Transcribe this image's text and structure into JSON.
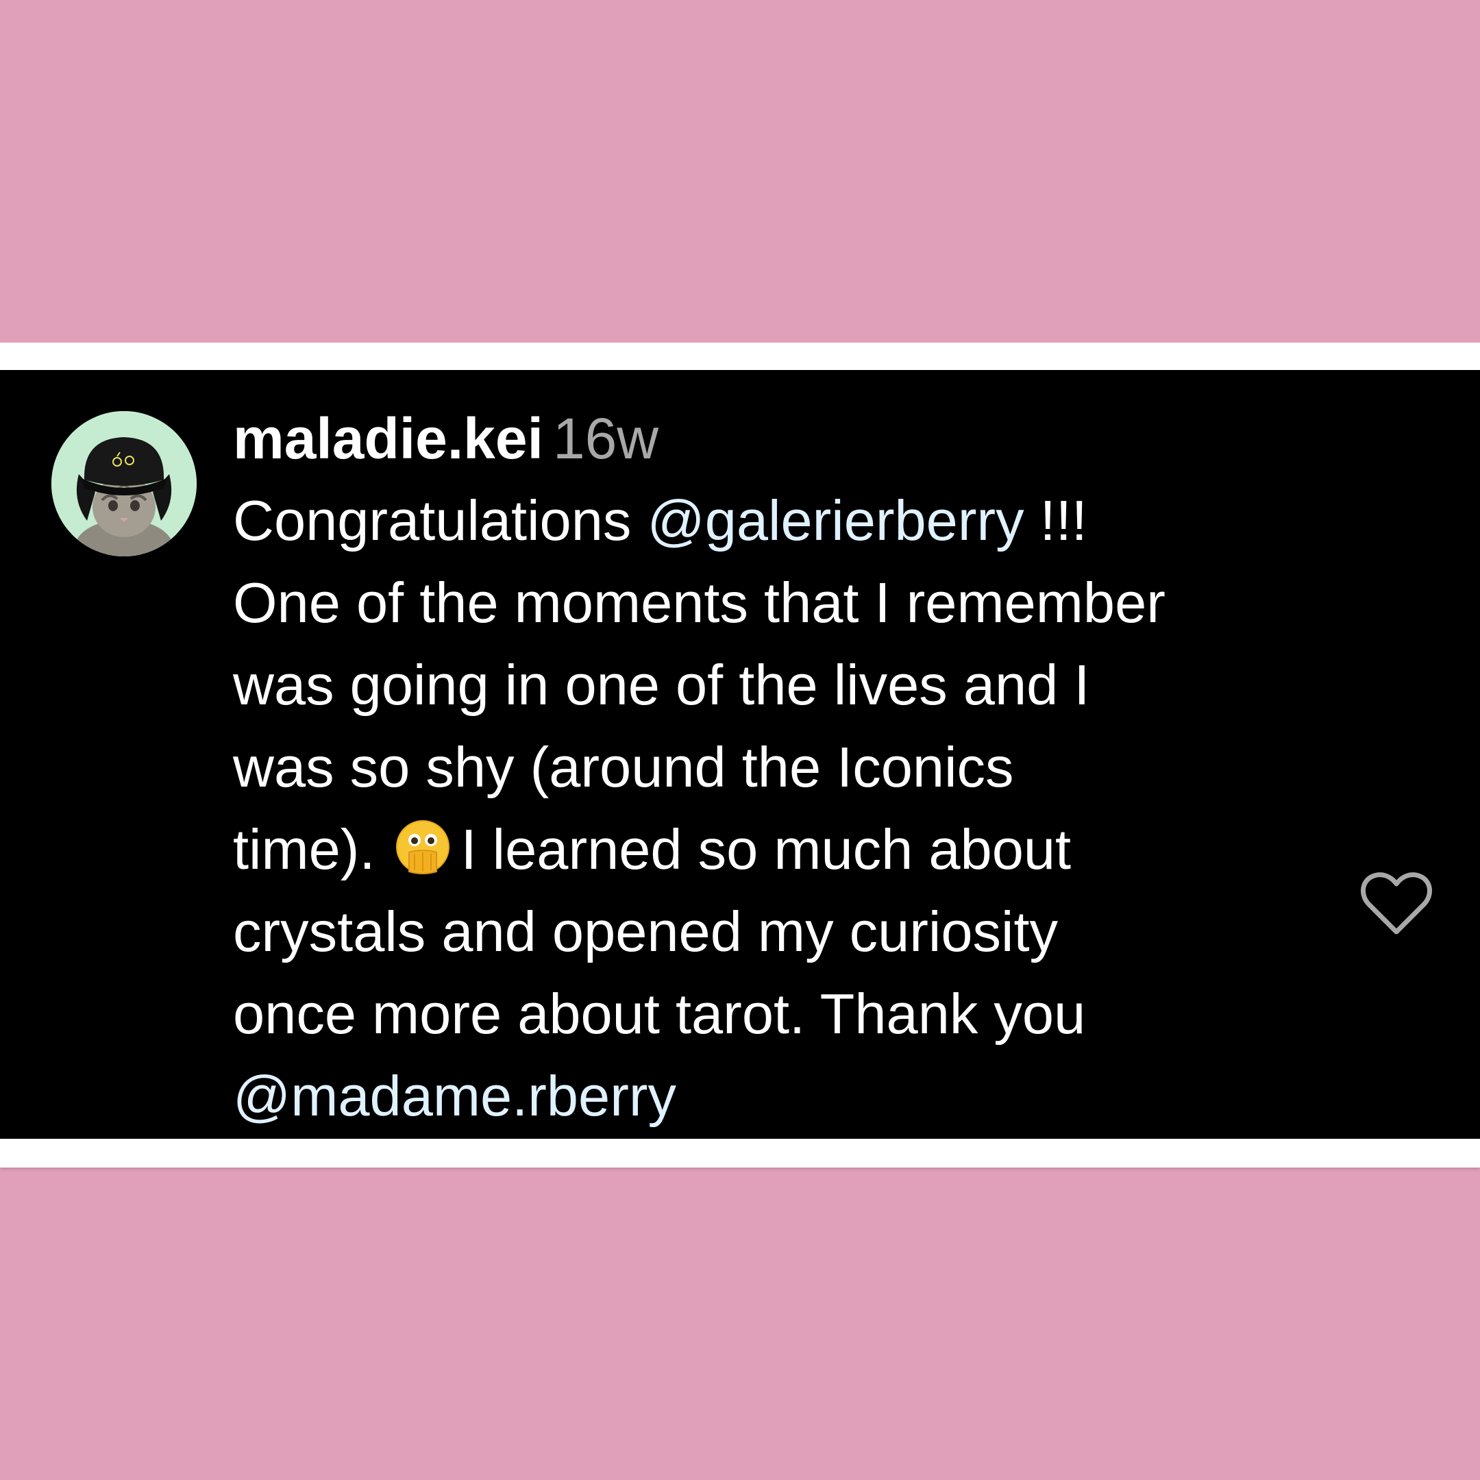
{
  "colors": {
    "background_pink": "#e0a0ba",
    "panel": "#000000",
    "text": "#ffffff",
    "timestamp": "#a8a8a8",
    "mention": "#e0f1ff",
    "avatar_bg": "#c5ecd0"
  },
  "comment": {
    "username": "maladie.kei",
    "timestamp": "16w",
    "avatar_icon": "cat-in-hat-avatar",
    "like_icon": "heart-outline-icon",
    "lines": {
      "l1_text": "Congratulations ",
      "l1_mention": "@galerierberry",
      "l1_tail": " !!!",
      "l2": "One of the moments that I remember",
      "l3": "was going in one of the lives and I",
      "l4": "was so shy (around the Iconics",
      "l5_pre": "time).",
      "l5_emoji": "face-with-open-eyes-and-hand-over-mouth",
      "l5_post": "I learned so much about",
      "l6": "crystals and opened my curiosity",
      "l7": "once more about tarot. Thank you",
      "l8_mention": "@madame.rberry"
    }
  }
}
